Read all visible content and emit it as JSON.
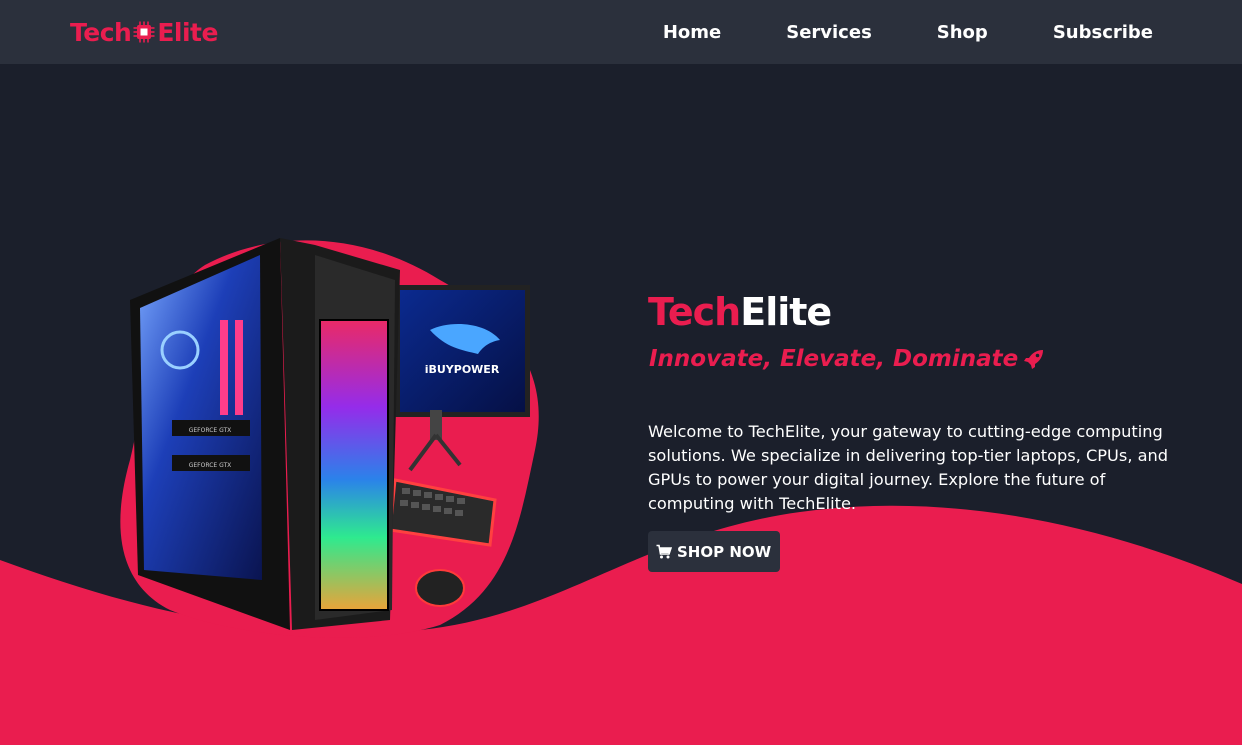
{
  "header": {
    "brand_part1": "Tech",
    "brand_part2": "Elite",
    "brand_icon": "cpu-chip-icon",
    "nav": [
      {
        "label": "Home"
      },
      {
        "label": "Services"
      },
      {
        "label": "Shop"
      },
      {
        "label": "Subscribe"
      }
    ]
  },
  "hero": {
    "title_accent": "Tech",
    "title_rest": "Elite",
    "tagline": "Innovate, Elevate, Dominate",
    "tagline_icon": "rocket-icon",
    "description": "Welcome to TechElite, your gateway to cutting-edge computing solutions. We specialize in delivering top-tier laptops, CPUs, and GPUs to power your digital journey. Explore the future of computing with TechElite.",
    "cta_label": "SHOP NOW",
    "cta_icon": "cart-icon",
    "product_image_text": "iBUYPOWER",
    "gpu_label": "GEFORCE GTX"
  },
  "colors": {
    "accent": "#ea1d4f",
    "background": "#1b1f2b",
    "navbar": "#2b303c",
    "text": "#ffffff"
  }
}
